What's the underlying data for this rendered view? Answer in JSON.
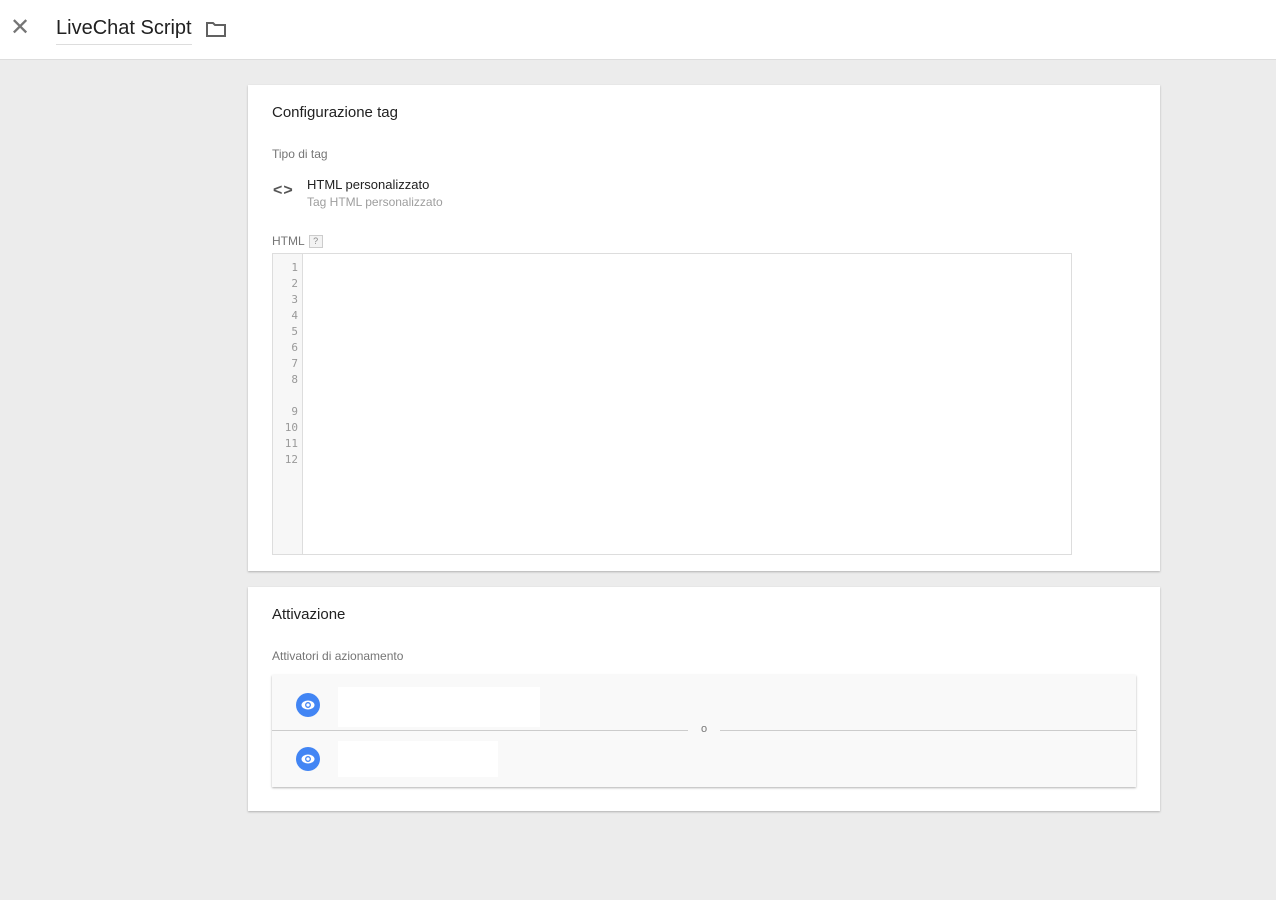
{
  "header": {
    "title": "LiveChat Script",
    "close_icon": "close-icon",
    "folder_icon": "folder-icon"
  },
  "config": {
    "heading": "Configurazione tag",
    "type_label": "Tipo di tag",
    "type_title": "HTML personalizzato",
    "type_subtitle": "Tag HTML personalizzato",
    "html_label": "HTML",
    "help": "?",
    "line_numbers": [
      "1",
      "2",
      "3",
      "4",
      "5",
      "6",
      "7",
      "8",
      "",
      "9",
      "10",
      "11",
      "12"
    ]
  },
  "triggering": {
    "heading": "Attivazione",
    "label": "Attivatori di azionamento",
    "separator": "o"
  },
  "colors": {
    "accent": "#4285f4"
  }
}
